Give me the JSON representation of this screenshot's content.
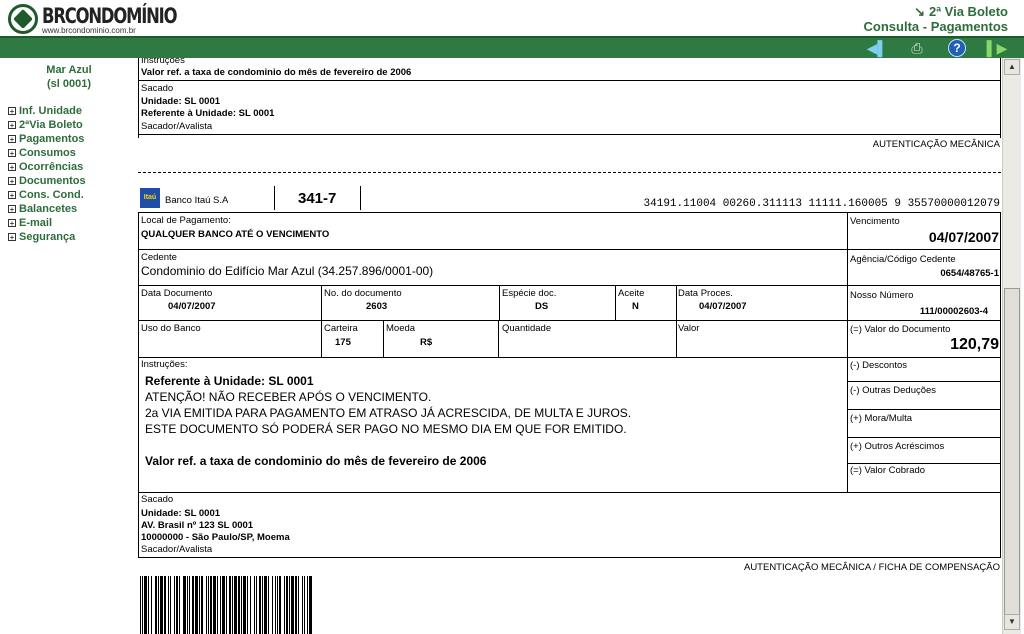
{
  "header": {
    "logo_name": "BRCONDOMÍNIO",
    "logo_url": "www.brcondominio.com.br",
    "title": "2ª Via Boleto",
    "subtitle": "Consulta - Pagamentos"
  },
  "toolbar": {
    "back_icon": "back-arrow-icon",
    "print_icon": "printer-icon",
    "help_icon": "help-icon",
    "next_icon": "forward-arrow-icon",
    "help_label": "?"
  },
  "sidebar": {
    "unit_name": "Mar Azul",
    "unit_code": "(sl 0001)",
    "items": [
      {
        "label": "Inf. Unidade"
      },
      {
        "label": "2ªVia Boleto"
      },
      {
        "label": "Pagamentos"
      },
      {
        "label": "Consumos"
      },
      {
        "label": "Ocorrências"
      },
      {
        "label": "Documentos"
      },
      {
        "label": "Cons. Cond."
      },
      {
        "label": "Balancetes"
      },
      {
        "label": "E-mail"
      },
      {
        "label": "Segurança"
      }
    ]
  },
  "receipt": {
    "instr_label": "Instruções",
    "instr_text": "Valor ref. a taxa de condominio do mês de fevereiro de 2006",
    "sacado_label": "Sacado",
    "sacado_line1": "Unidade: SL 0001",
    "sacado_line2": "Referente à Unidade: SL 0001",
    "avalista_label": "Sacador/Avalista",
    "autenticacao": "AUTENTICAÇÃO MECÂNICA"
  },
  "slip": {
    "bank_logo": "Itaú",
    "bank_name": "Banco Itaú S.A",
    "bank_code": "341-7",
    "digitable_line": "34191.11004 00260.311113 11111.160005 9 35570000012079",
    "local_label": "Local de Pagamento:",
    "local_value": "QUALQUER BANCO ATÉ O VENCIMENTO",
    "venc_label": "Vencimento",
    "venc_value": "04/07/2007",
    "cedente_label": "Cedente",
    "cedente_value": "Condominio do Edifício Mar Azul (34.257.896/0001-00)",
    "agencia_label": "Agência/Código Cedente",
    "agencia_value": "0654/48765-1",
    "data_doc_label": "Data Documento",
    "data_doc_value": "04/07/2007",
    "num_doc_label": "No. do documento",
    "num_doc_value": "2603",
    "especie_label": "Espécie doc.",
    "especie_value": "DS",
    "aceite_label": "Aceite",
    "aceite_value": "N",
    "data_proc_label": "Data Proces.",
    "data_proc_value": "04/07/2007",
    "nosso_label": "Nosso Número",
    "nosso_value": "111/00002603-4",
    "uso_label": "Uso do Banco",
    "carteira_label": "Carteira",
    "carteira_value": "175",
    "moeda_label": "Moeda",
    "moeda_value": "R$",
    "quantidade_label": "Quantidade",
    "valor_label": "Valor",
    "valor_doc_label": "(=) Valor do Documento",
    "valor_doc_value": "120,79",
    "instr_label": "Instruções:",
    "instr_lines": [
      "Referente à Unidade: SL 0001",
      "ATENÇÃO! NÃO RECEBER APÓS O VENCIMENTO.",
      "2a VIA EMITIDA PARA PAGAMENTO EM ATRASO JÁ ACRESCIDA, DE MULTA E JUROS.",
      "ESTE DOCUMENTO SÓ PODERÁ SER PAGO NO MESMO DIA EM QUE FOR EMITIDO.",
      "",
      "Valor ref. a taxa de condominio do mês de fevereiro de 2006"
    ],
    "descontos_label": "(-) Descontos",
    "deducoes_label": "(-) Outras Deduções",
    "mora_label": "(+) Mora/Multa",
    "acrescimos_label": "(+) Outros Acréscimos",
    "cobrado_label": "(=) Valor Cobrado",
    "sacado_label": "Sacado",
    "sacado_line1": "Unidade: SL 0001",
    "sacado_line2": "AV. Brasil nº 123 SL 0001",
    "sacado_line3": "10000000 - São Paulo/SP, Moema",
    "avalista_label": "Sacador/Avalista",
    "autenticacao": "AUTENTICAÇÃO MECÂNICA / FICHA DE COMPENSAÇÃO"
  }
}
